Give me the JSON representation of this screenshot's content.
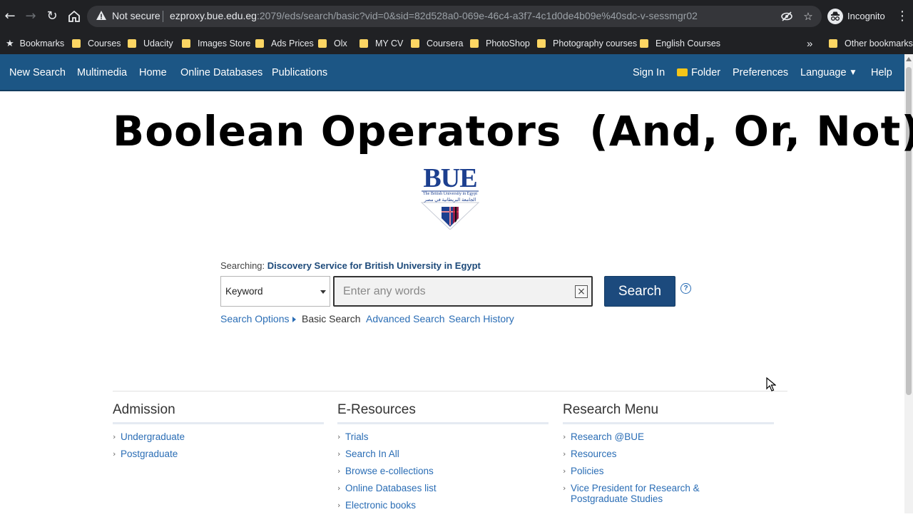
{
  "browser": {
    "not_secure": "Not secure",
    "url_host": "ezproxy.bue.edu.eg",
    "url_rest": ":2079/eds/search/basic?vid=0&sid=82d528a0-069e-46c4-a3f7-4c1d0de4b09e%40sdc-v-sessmgr02",
    "profile": "Incognito",
    "bookmarks_label": "Bookmarks",
    "bookmarks": [
      "Courses",
      "Udacity",
      "Images Store",
      "Ads Prices",
      "Olx",
      "MY CV",
      "Coursera",
      "PhotoShop",
      "Photography courses",
      "English Courses"
    ],
    "other_bookmarks": "Other bookmarks",
    "overflow": "»"
  },
  "topnav": {
    "left": [
      "New Search",
      "Multimedia",
      "Home",
      "Online Databases",
      "Publications"
    ],
    "sign_in": "Sign In",
    "folder": "Folder",
    "preferences": "Preferences",
    "language": "Language",
    "help": "Help"
  },
  "headline": {
    "part1": "Boolean Operators",
    "part2": "(And, Or, Not)"
  },
  "logo": {
    "text": "BUE",
    "subtitle": "The British University in Egypt",
    "arabic": "الجامعة البريطانية في مصر"
  },
  "search": {
    "searching_label": "Searching:",
    "database": "Discovery Service for British University in Egypt",
    "field_selected": "Keyword",
    "placeholder": "Enter any words",
    "button": "Search",
    "help": "?",
    "clear": "×",
    "links": {
      "options": "Search Options",
      "basic": "Basic Search",
      "advanced": "Advanced Search",
      "history": "Search History"
    }
  },
  "columns": [
    {
      "title": "Admission",
      "items": [
        "Undergraduate",
        "Postgraduate"
      ]
    },
    {
      "title": "E-Resources",
      "items": [
        "Trials",
        "Search In All",
        "Browse e-collections",
        "Online Databases list",
        "Electronic books"
      ]
    },
    {
      "title": "Research Menu",
      "items": [
        "Research @BUE",
        "Resources",
        "Policies",
        "Vice President for Research & Postgraduate Studies"
      ]
    }
  ],
  "colors": {
    "nav_bar": "#1c5685",
    "search_button": "#1c4a7d",
    "link": "#2a6db5",
    "chrome_bg": "#202124",
    "folder": "#fdd663"
  }
}
